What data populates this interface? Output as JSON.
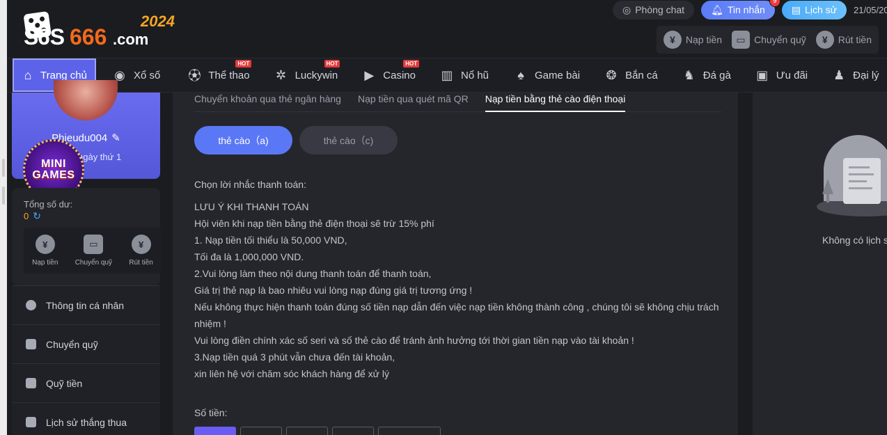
{
  "header": {
    "logo_text": "S6S666.com",
    "logo_year": "2024",
    "phong_chat": "Phòng chat",
    "tin_nhan": "Tin nhắn",
    "tin_nhan_count": "9",
    "lich_su": "Lịch sử",
    "date": "21/05/20",
    "wallet": {
      "nap_tien": "Nạp tiền",
      "chuyen_quy": "Chuyển quỹ",
      "rut_tien": "Rút tiền"
    }
  },
  "nav": {
    "items": [
      {
        "label": "Trang chủ",
        "icon": "home-icon",
        "active": true
      },
      {
        "label": "Xổ số",
        "icon": "lottery-icon"
      },
      {
        "label": "Thể thao",
        "icon": "soccer-icon",
        "hot": "HOT"
      },
      {
        "label": "Luckywin",
        "icon": "wheel-icon",
        "hot": "HOT"
      },
      {
        "label": "Casino",
        "icon": "play-icon",
        "hot": "HOT"
      },
      {
        "label": "Nổ hũ",
        "icon": "slot-icon"
      },
      {
        "label": "Game bài",
        "icon": "cards-icon"
      },
      {
        "label": "Bắn cá",
        "icon": "fish-icon"
      },
      {
        "label": "Đá gà",
        "icon": "rooster-icon"
      },
      {
        "label": "Ưu đãi",
        "icon": "gift-icon"
      },
      {
        "label": "Đại lý",
        "icon": "agent-icon"
      }
    ]
  },
  "sidebar": {
    "username": "Phieudu004",
    "day_text": "ngày thứ 1",
    "mini_games_line1": "MINI",
    "mini_games_line2": "GAMES",
    "balance_label": "Tổng số dư:",
    "balance_value": "0",
    "actions": {
      "nap_tien": "Nạp tiền",
      "chuyen_quy": "Chuyển quỹ",
      "rut_tien": "Rút tiền"
    },
    "menu": [
      {
        "label": "Thông tin cá nhân",
        "icon": "user-icon"
      },
      {
        "label": "Chuyển quỹ",
        "icon": "wallet-icon"
      },
      {
        "label": "Quỹ tiền",
        "icon": "fund-icon"
      },
      {
        "label": "Lịch sử thắng thua",
        "icon": "history-icon"
      }
    ]
  },
  "main": {
    "tabs": [
      {
        "label": "Chuyển khoản qua thẻ ngân hàng"
      },
      {
        "label": "Nạp tiền qua quét mã QR"
      },
      {
        "label": "Nạp tiền bằng thẻ cào điện thoại",
        "active": true
      }
    ],
    "subtabs": [
      {
        "label": "thẻ cào（a)",
        "active": true
      },
      {
        "label": "thẻ cào（c)"
      }
    ],
    "prompt_label": "Chọn lời nhắc thanh toán:",
    "notice_lines": [
      "LƯU Ý KHI THANH TOÁN",
      "Hội viên khi nạp tiền bằng thẻ điện thoại sẽ trừ 15% phí",
      "1. Nạp tiền tối thiểu là 50,000 VND,",
      "Tối đa là 1,000,000 VND.",
      "2.Vui lòng làm theo nội dung thanh toán để thanh toán,",
      "Giá trị thẻ nạp là bao nhiêu vui lòng nạp đúng giá trị tương ứng !",
      "Nếu không thực hiện thanh toán đúng số tiền nạp dẫn đến việc nạp tiền không thành công , chúng tôi sẽ không chịu trách nhiệm !",
      "Vui lòng điền chính xác số seri và số thẻ cào để tránh ảnh hưởng tới thời gian tiền nạp vào tài khoản !",
      "3.Nạp tiền quá 3 phút vẫn chưa đến tài khoản,",
      "xin liên hệ với chăm sóc khách hàng để xử lý"
    ],
    "amount_label": "Số tiền:"
  },
  "right_panel": {
    "empty_text": "Không có lịch sử"
  },
  "colors": {
    "accent": "#5d63e8",
    "bg": "#1b1c20",
    "panel": "#25262b",
    "balance": "#f5a623",
    "badge": "#f03a3a"
  }
}
